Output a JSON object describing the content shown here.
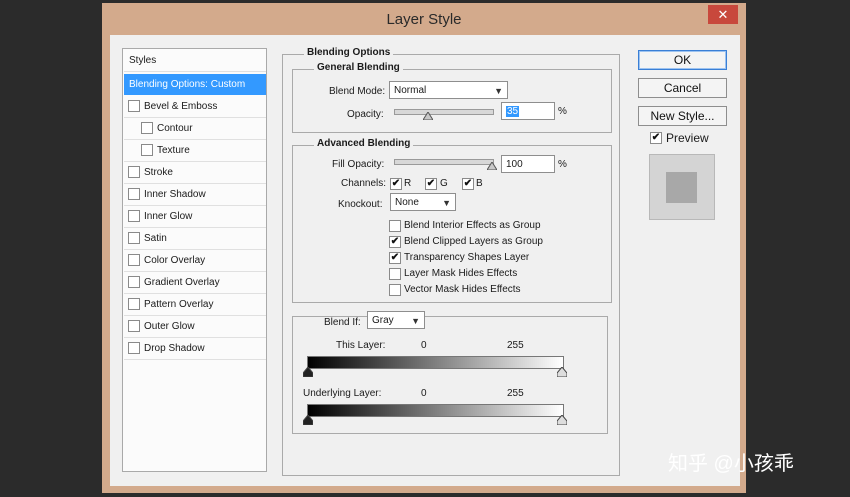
{
  "window": {
    "title": "Layer Style",
    "close_glyph": "✕"
  },
  "sidebar": {
    "items": [
      {
        "label": "Styles",
        "checkbox": false,
        "checked": false,
        "selected": false,
        "indent": 0
      },
      {
        "label": "Blending Options: Custom",
        "checkbox": false,
        "checked": false,
        "selected": true,
        "indent": 0
      },
      {
        "label": "Bevel & Emboss",
        "checkbox": true,
        "checked": false,
        "selected": false,
        "indent": 0
      },
      {
        "label": "Contour",
        "checkbox": true,
        "checked": false,
        "selected": false,
        "indent": 1
      },
      {
        "label": "Texture",
        "checkbox": true,
        "checked": false,
        "selected": false,
        "indent": 1
      },
      {
        "label": "Stroke",
        "checkbox": true,
        "checked": false,
        "selected": false,
        "indent": 0
      },
      {
        "label": "Inner Shadow",
        "checkbox": true,
        "checked": false,
        "selected": false,
        "indent": 0
      },
      {
        "label": "Inner Glow",
        "checkbox": true,
        "checked": false,
        "selected": false,
        "indent": 0
      },
      {
        "label": "Satin",
        "checkbox": true,
        "checked": false,
        "selected": false,
        "indent": 0
      },
      {
        "label": "Color Overlay",
        "checkbox": true,
        "checked": false,
        "selected": false,
        "indent": 0
      },
      {
        "label": "Gradient Overlay",
        "checkbox": true,
        "checked": false,
        "selected": false,
        "indent": 0
      },
      {
        "label": "Pattern Overlay",
        "checkbox": true,
        "checked": false,
        "selected": false,
        "indent": 0
      },
      {
        "label": "Outer Glow",
        "checkbox": true,
        "checked": false,
        "selected": false,
        "indent": 0
      },
      {
        "label": "Drop Shadow",
        "checkbox": true,
        "checked": false,
        "selected": false,
        "indent": 0
      }
    ]
  },
  "blending": {
    "section_title": "Blending Options",
    "general": {
      "title": "General Blending",
      "blend_mode_label": "Blend Mode:",
      "blend_mode_value": "Normal",
      "opacity_label": "Opacity:",
      "opacity_value": "35",
      "opacity_fraction": 0.35,
      "percent": "%"
    },
    "advanced": {
      "title": "Advanced Blending",
      "fill_opacity_label": "Fill Opacity:",
      "fill_opacity_value": "100",
      "fill_fraction": 1.0,
      "percent": "%",
      "channels_label": "Channels:",
      "channel_r": "R",
      "channel_g": "G",
      "channel_b": "B",
      "knockout_label": "Knockout:",
      "knockout_value": "None",
      "options": [
        {
          "label": "Blend Interior Effects as Group",
          "checked": false
        },
        {
          "label": "Blend Clipped Layers as Group",
          "checked": true
        },
        {
          "label": "Transparency Shapes Layer",
          "checked": true
        },
        {
          "label": "Layer Mask Hides Effects",
          "checked": false
        },
        {
          "label": "Vector Mask Hides Effects",
          "checked": false
        }
      ]
    },
    "blend_if": {
      "label": "Blend If:",
      "value": "Gray",
      "this_layer_label": "This Layer:",
      "this_layer_min": "0",
      "this_layer_max": "255",
      "underlying_label": "Underlying Layer:",
      "underlying_min": "0",
      "underlying_max": "255"
    }
  },
  "buttons": {
    "ok": "OK",
    "cancel": "Cancel",
    "new_style": "New Style..."
  },
  "preview": {
    "label": "Preview",
    "checked": true
  },
  "check_glyph": "✔",
  "arrow_glyph": "▼",
  "watermark": "知乎 @小孩乖"
}
